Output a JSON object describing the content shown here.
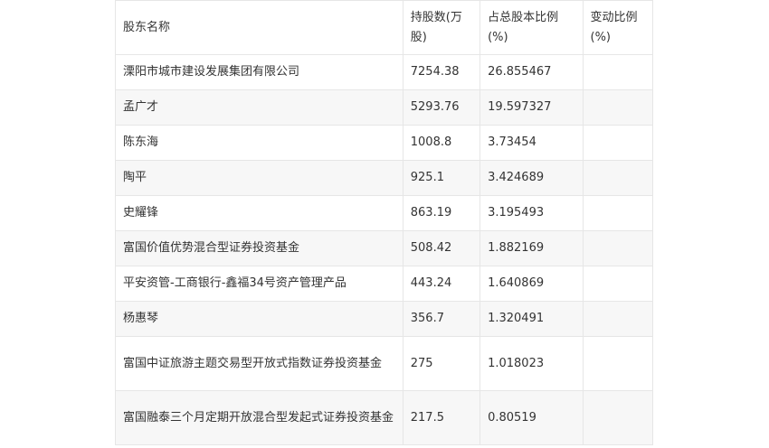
{
  "table": {
    "headers": {
      "name": "股东名称",
      "shares": "持股数(万股)",
      "ratio": "占总股本比例(%)",
      "change": "变动比例(%)"
    },
    "rows": [
      {
        "name": "溧阳市城市建设发展集团有限公司",
        "shares": "7254.38",
        "ratio": "26.855467",
        "change": ""
      },
      {
        "name": "孟广才",
        "shares": "5293.76",
        "ratio": "19.597327",
        "change": ""
      },
      {
        "name": "陈东海",
        "shares": "1008.8",
        "ratio": "3.73454",
        "change": ""
      },
      {
        "name": "陶平",
        "shares": "925.1",
        "ratio": "3.424689",
        "change": ""
      },
      {
        "name": "史耀锋",
        "shares": "863.19",
        "ratio": "3.195493",
        "change": ""
      },
      {
        "name": "富国价值优势混合型证券投资基金",
        "shares": "508.42",
        "ratio": "1.882169",
        "change": ""
      },
      {
        "name": "平安资管-工商银行-鑫福34号资产管理产品",
        "shares": "443.24",
        "ratio": "1.640869",
        "change": ""
      },
      {
        "name": "杨惠琴",
        "shares": "356.7",
        "ratio": "1.320491",
        "change": ""
      },
      {
        "name": "富国中证旅游主题交易型开放式指数证券投资基金",
        "shares": "275",
        "ratio": "1.018023",
        "change": ""
      },
      {
        "name": "富国融泰三个月定期开放混合型发起式证券投资基金",
        "shares": "217.5",
        "ratio": "0.80519",
        "change": ""
      }
    ]
  }
}
